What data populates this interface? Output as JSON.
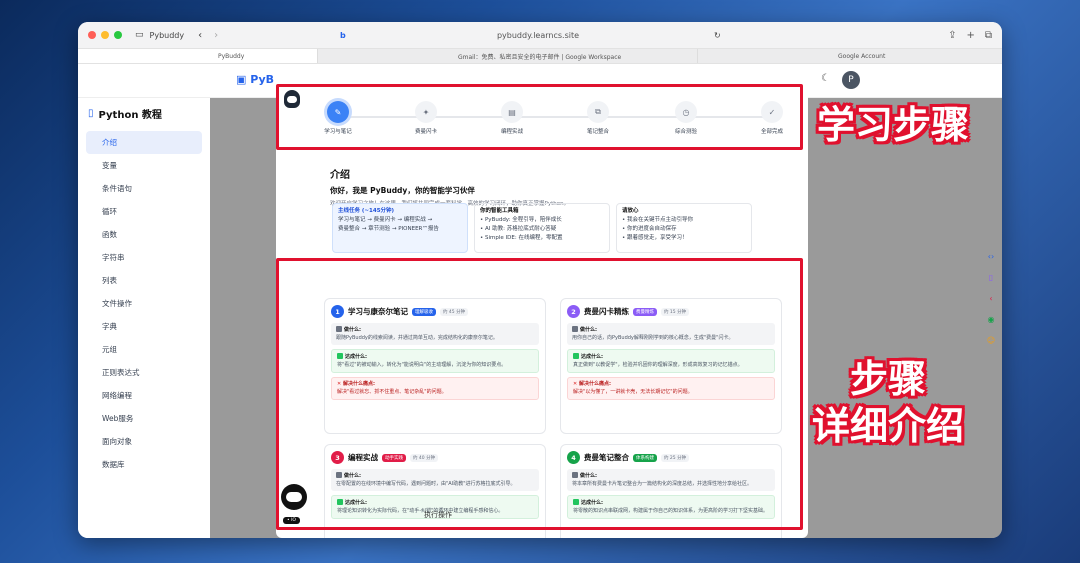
{
  "browser": {
    "tab_group_label": "Pybuddy",
    "address": "pybuddy.learncs.site",
    "tabs": [
      {
        "label": "PyBuddy"
      },
      {
        "label": "Gmail：免费、私密且安全的电子邮件 | Google Workspace"
      },
      {
        "label": "Google Account"
      }
    ]
  },
  "site": {
    "brand": "PyB",
    "avatar_letter": "P"
  },
  "sidebar": {
    "title": "Python 教程",
    "items": [
      "介绍",
      "变量",
      "条件语句",
      "循环",
      "函数",
      "字符串",
      "列表",
      "文件操作",
      "字典",
      "元组",
      "正则表达式",
      "网络编程",
      "Web服务",
      "面向对象",
      "数据库"
    ]
  },
  "steps": [
    {
      "label": "学习与笔记"
    },
    {
      "label": "费曼闪卡"
    },
    {
      "label": "编程实战"
    },
    {
      "label": "笔记整合"
    },
    {
      "label": "综合测验"
    },
    {
      "label": "全部完成"
    }
  ],
  "intro": {
    "heading": "介绍",
    "greeting": "你好，我是 PyBuddy，你的智能学习伙伴",
    "description": "欢迎开启学习之旅！在这里，我们将共同完成一套科学、高效的学习闭环，助你真正掌握Python。",
    "col1_title": "主线任务 (~145分钟)",
    "col1_lines": [
      "学习与笔记 → 费曼闪卡 → 编程实战 →",
      "费曼整合 → 章节测验 → PIONEER™报告"
    ],
    "col2_title": "你的智能工具箱",
    "col2_lines": [
      "• PyBuddy: 全程引导，陪伴成长",
      "• AI 助教: 苏格拉底式耐心答疑",
      "• Simple IDE: 在线编程，零配置"
    ],
    "col3_title": "请放心",
    "col3_lines": [
      "• 我会在关键节点主动引导你",
      "• 你的进度会自动保存",
      "• 跟着感觉走，享受学习！"
    ]
  },
  "cards": [
    {
      "num": "1",
      "title": "学习与康奈尔笔记",
      "tag": "理解吸收",
      "duration": "约 45 分钟",
      "what_label": "做什么:",
      "what": "跟随PyBuddy的线索阅读，并通过简单互动，完成结构化的康奈尔笔记。",
      "goal_label": "达成什么:",
      "goal": "将\"看过\"的被动输入，转化为\"能说明白\"的主动理解，沉淀为你的知识要点。",
      "fix_label": "解决什么痛点:",
      "fix": "解决\"看过就忘、抓不住重点、笔记杂乱\"的问题。"
    },
    {
      "num": "2",
      "title": "费曼闪卡精炼",
      "tag": "费曼精炼",
      "duration": "约 15 分钟",
      "what_label": "做什么:",
      "what": "用你自己的话，向PyBuddy解释刚刚学到的核心概念，生成\"费曼\"闪卡。",
      "goal_label": "达成什么:",
      "goal": "真正做到\"以教促学\"，检验并巩固你的理解深度，形成高效复习的记忆锚点。",
      "fix_label": "解决什么痛点:",
      "fix": "解决\"以为懂了，一讲就卡壳，无法长期记忆\"的问题。"
    },
    {
      "num": "3",
      "title": "编程实战",
      "tag": "动手实践",
      "duration": "约 40 分钟",
      "what_label": "做什么:",
      "what": "在零配置的在线环境中编写代码，遇到问题时，由\"AI助教\"进行苏格拉底式引导。",
      "goal_label": "达成什么:",
      "goal": "将理论知识转化为实际代码，在\"动手-纠错\"的循环中建立编程手感和信心。"
    },
    {
      "num": "4",
      "title": "费曼笔记整合",
      "tag": "体系构建",
      "duration": "约 25 分钟",
      "what_label": "做什么:",
      "what": "将本章所有费曼卡片笔记整合为一篇结构化的深度总结，并选择性地分享给社区。",
      "goal_label": "达成什么:",
      "goal": "将零散的知识点串联成网，构建属于你自己的知识体系，为更高阶的学习打下坚实基础。"
    }
  ],
  "footer_partial": "执行操作",
  "mascot_badge": "• IO",
  "annotations": {
    "top_label": "学习步骤",
    "bottom_label_line1": "步骤",
    "bottom_label_line2": "详细介绍",
    "color": "#e0112e"
  },
  "colors": {
    "primary": "#3b82f6",
    "card1": "#2563eb",
    "card2": "#8b5cf6",
    "card3": "#e11d48",
    "card4": "#16a34a"
  }
}
